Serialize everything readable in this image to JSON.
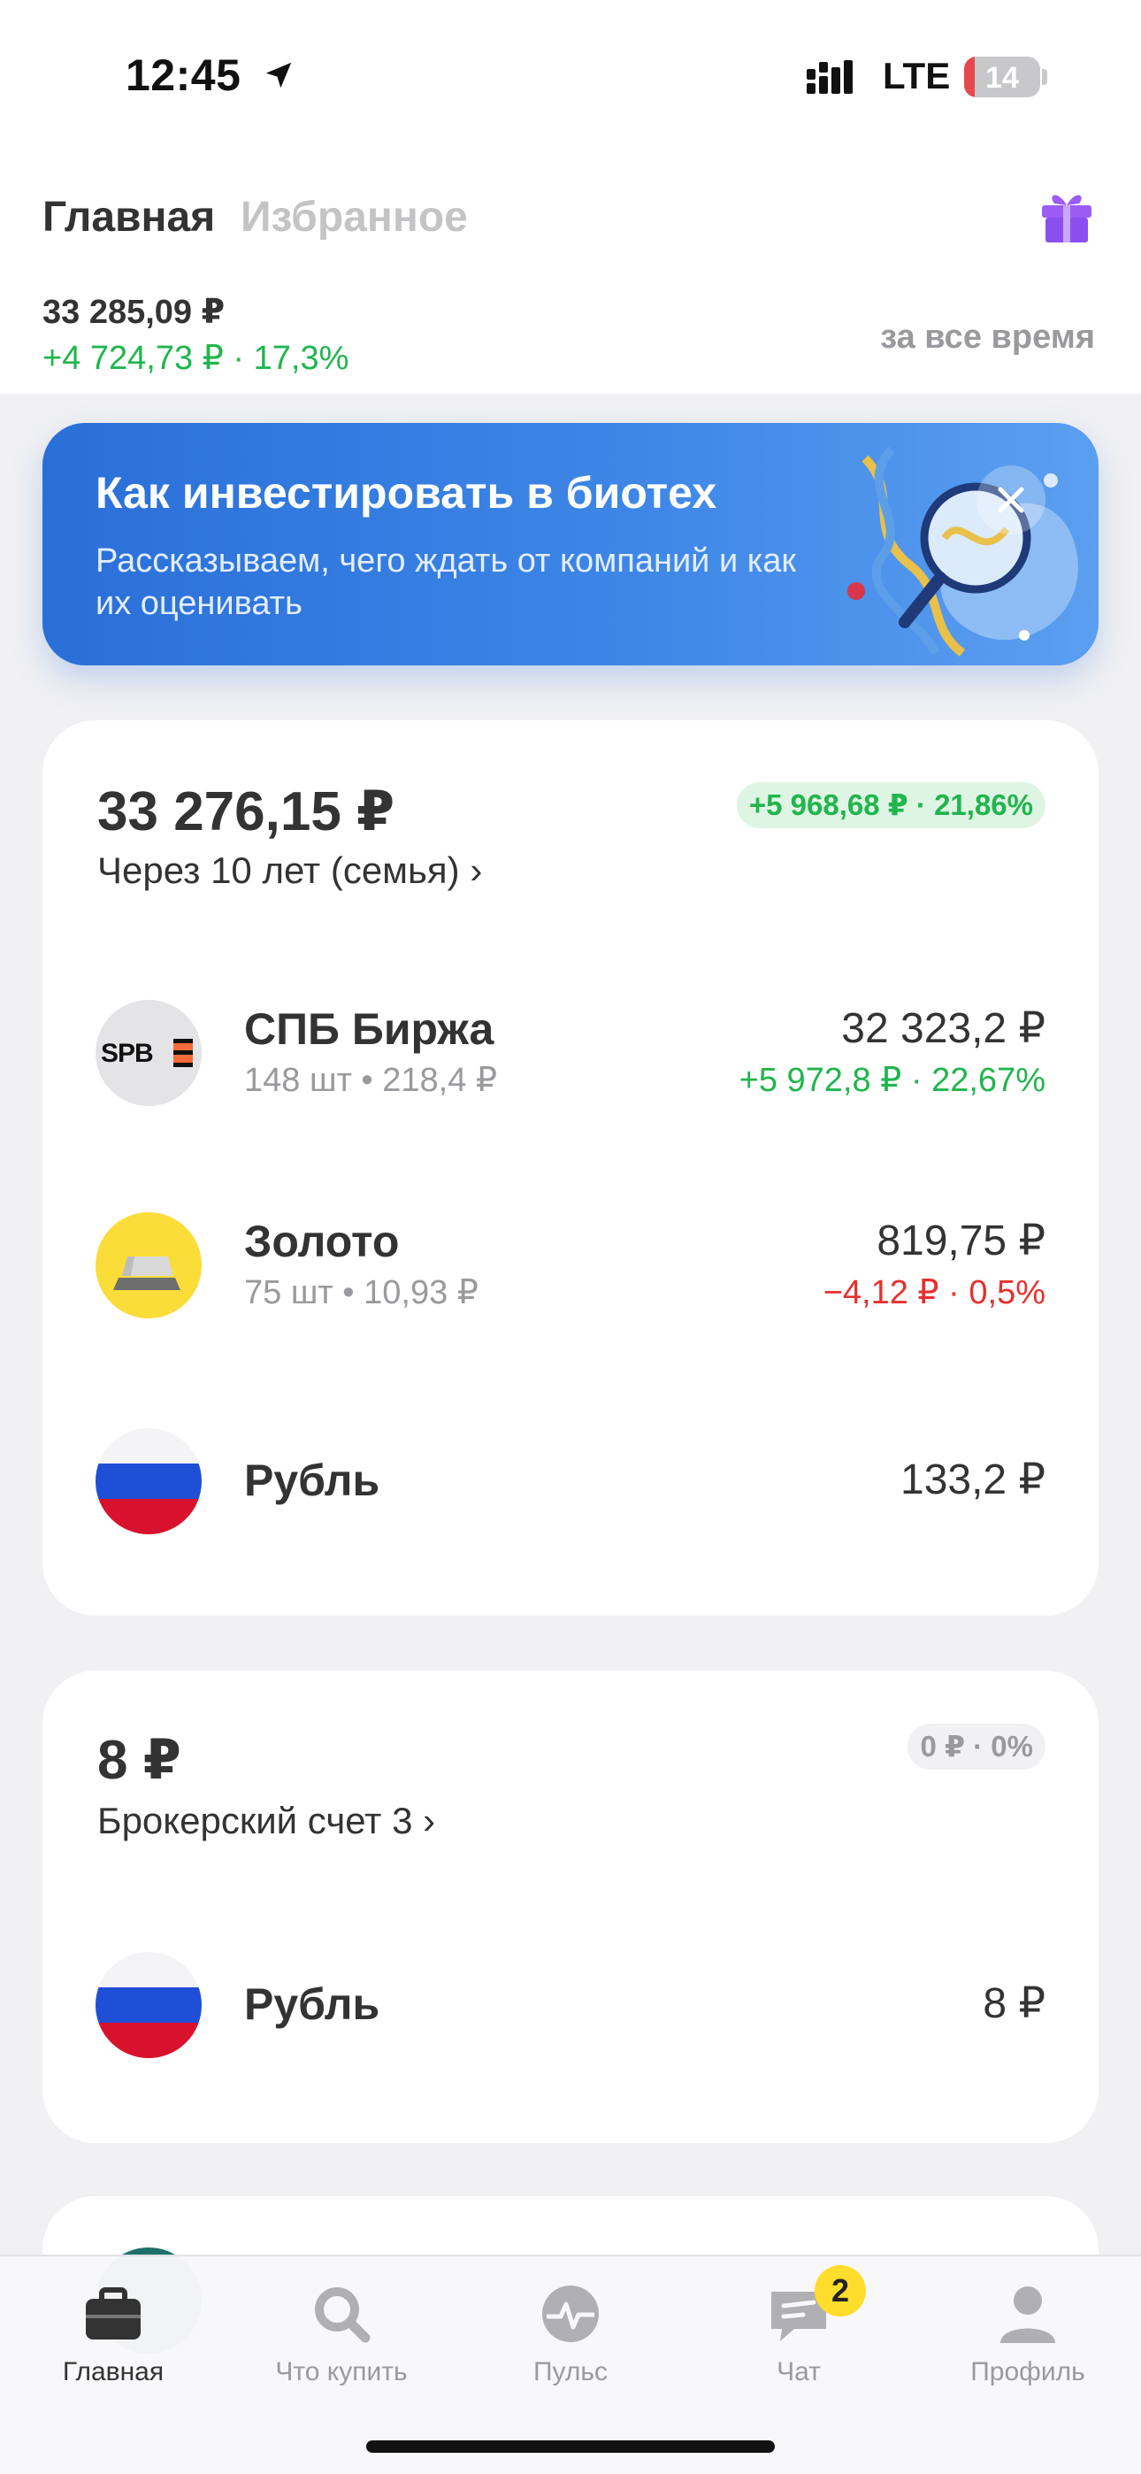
{
  "status_bar": {
    "time": "12:45",
    "network": "LTE",
    "battery": "14",
    "battery_level_percent": 14,
    "battery_color": "#e5484d"
  },
  "header": {
    "tabs": [
      "Главная",
      "Избранное"
    ],
    "active_tab": "Главная",
    "gift_icon": "gift-icon",
    "total_value": "33 285,09 ₽",
    "total_change": "+4 724,73 ₽ · 17,3%",
    "period": "за все время"
  },
  "banner": {
    "title": "Как инвестировать в биотех",
    "subtitle": "Рассказываем, чего ждать от компаний и как их оценивать",
    "art_icon": "dna-magnifier-illustration",
    "close_icon": "close-icon"
  },
  "accounts": [
    {
      "value": "33 276,15 ₽",
      "name": "Через 10 лет (семья) ›",
      "change": "+5 968,68 ₽ · 21,86%",
      "change_color": "#21b54d",
      "assets": [
        {
          "logo": "spb-exchange-logo",
          "logo_text": "SPB",
          "name": "СПБ Биржа",
          "sub": "148 шт • 218,4 ₽",
          "value": "32 323,2 ₽",
          "change": "+5 972,8 ₽ · 22,67%",
          "change_color": "#21b54d"
        },
        {
          "logo": "gold-bar-icon",
          "name": "Золото",
          "sub": "75 шт • 10,93 ₽",
          "value": "819,75 ₽",
          "change": "−4,12 ₽ · 0,5%",
          "change_color": "#e5312e"
        },
        {
          "logo": "russia-flag-icon",
          "name": "Рубль",
          "value": "133,2 ₽"
        }
      ]
    },
    {
      "value": "8 ₽",
      "name": "Брокерский счет 3 ›",
      "change": "0 ₽ · 0%",
      "change_color": "#9a9a9e",
      "assets": [
        {
          "logo": "russia-flag-icon",
          "name": "Рубль",
          "value": "8 ₽"
        }
      ]
    }
  ],
  "tabbar": {
    "items": [
      {
        "label": "Главная",
        "icon": "briefcase-icon",
        "active": true
      },
      {
        "label": "Что купить",
        "icon": "search-icon",
        "active": false
      },
      {
        "label": "Пульс",
        "icon": "pulse-icon",
        "active": false
      },
      {
        "label": "Чат",
        "icon": "chat-icon",
        "active": false,
        "badge": "2"
      },
      {
        "label": "Профиль",
        "icon": "profile-icon",
        "active": false
      }
    ]
  }
}
